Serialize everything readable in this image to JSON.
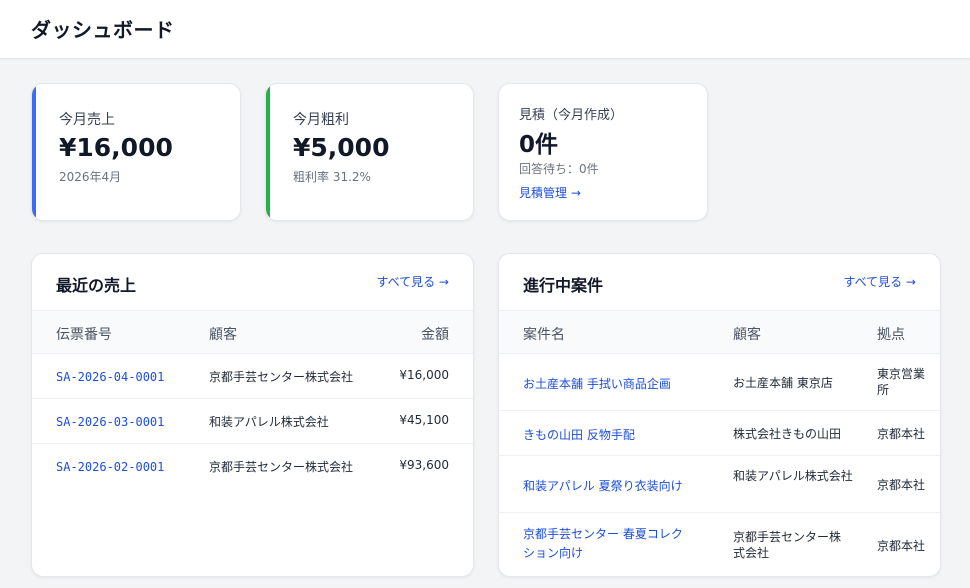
{
  "header": {
    "title": "ダッシュボード"
  },
  "colors": {
    "accent_blue": "#3b6cf5",
    "accent_green": "#22b04a",
    "link": "#1d4ed8"
  },
  "stats": [
    {
      "label": "今月売上",
      "value": "¥16,000",
      "sub": "2026年4月"
    },
    {
      "label": "今月粗利",
      "value": "¥5,000",
      "sub": "粗利率 31.2%"
    }
  ],
  "quotes": {
    "label": "見積（今月作成）",
    "value": "0件",
    "sub": "回答待ち：0件",
    "link": "見積管理 →"
  },
  "recent_sales": {
    "title": "最近の売上",
    "link": "すべて見る →",
    "columns": [
      "伝票番号",
      "顧客",
      "金額"
    ],
    "rows": [
      {
        "slip": "SA-2026-04-0001",
        "customer": "京都手芸センター株式会社",
        "amount": "¥16,000"
      },
      {
        "slip": "SA-2026-03-0001",
        "customer": "和装アパレル株式会社",
        "amount": "¥45,100"
      },
      {
        "slip": "SA-2026-02-0001",
        "customer": "京都手芸センター株式会社",
        "amount": "¥93,600"
      }
    ]
  },
  "projects": {
    "title": "進行中案件",
    "link": "すべて見る →",
    "columns": [
      "案件名",
      "顧客",
      "拠点"
    ],
    "rows": [
      {
        "name": "お土産本舗 手拭い商品企画",
        "customer": "お土産本舗 東京店",
        "base": "東京営業所"
      },
      {
        "name": "きもの山田 反物手配",
        "customer": "株式会社きもの山田",
        "base": "京都本社"
      },
      {
        "name": "和装アパレル 夏祭り衣装向け",
        "customer": "和装アパレル株式会社",
        "base": "京都本社"
      },
      {
        "name": "京都手芸センター 春夏コレクション向け",
        "customer": "京都手芸センター株式会社",
        "base": "京都本社"
      }
    ]
  }
}
